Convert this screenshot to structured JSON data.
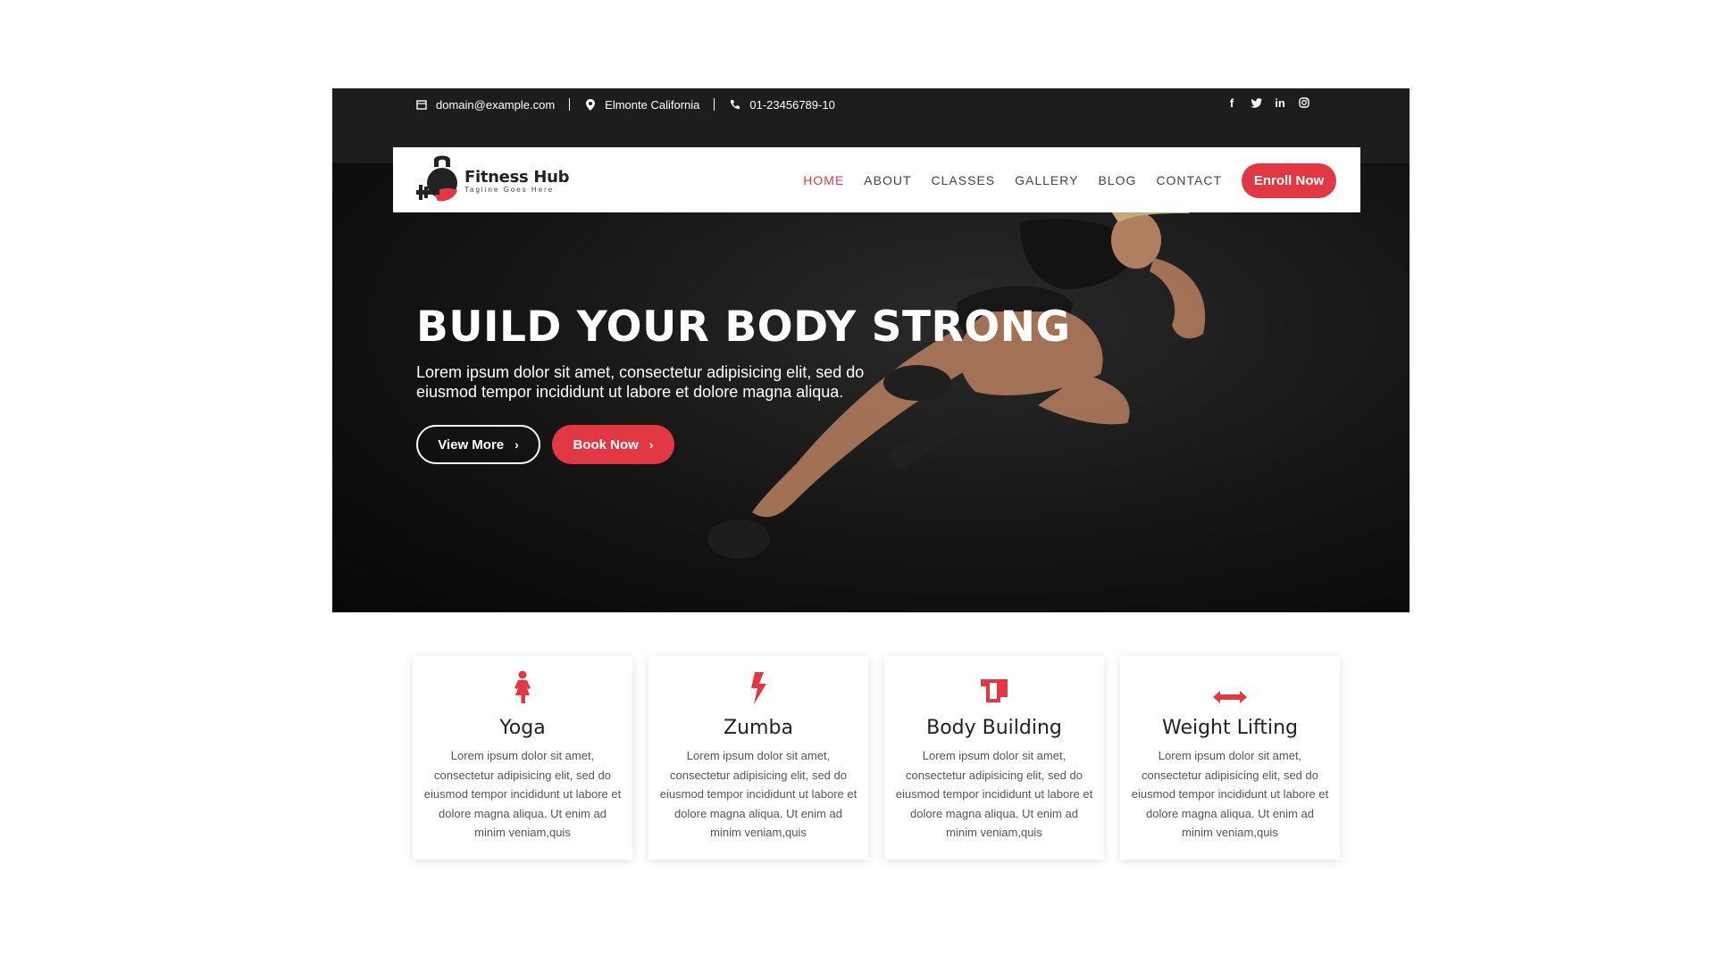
{
  "topbar": {
    "email": "domain@example.com",
    "location": "Elmonte California",
    "phone": "01-23456789-10",
    "social": [
      "facebook-icon",
      "twitter-icon",
      "linkedin-icon",
      "instagram-icon"
    ]
  },
  "brand": {
    "name": "Fitness Hub",
    "tagline": "Tagline Goes Here",
    "accent": "#e23844"
  },
  "nav": {
    "items": [
      {
        "label": "HOME",
        "active": true
      },
      {
        "label": "ABOUT"
      },
      {
        "label": "CLASSES"
      },
      {
        "label": "GALLERY"
      },
      {
        "label": "BLOG"
      },
      {
        "label": "CONTACT"
      }
    ],
    "cta": "Enroll Now"
  },
  "hero": {
    "title": "BUILD YOUR BODY STRONG",
    "text": "Lorem ipsum dolor sit amet, consectetur adipisicing elit, sed do eiusmod tempor incididunt ut labore et dolore magna aliqua.",
    "primary_button": "View More",
    "secondary_button": "Book Now"
  },
  "features": [
    {
      "icon": "female-icon",
      "title": "Yoga",
      "text": "Lorem ipsum dolor sit amet, consectetur adipisicing elit, sed do eiusmod tempor incididunt ut labore et dolore magna aliqua. Ut enim ad minim veniam,quis"
    },
    {
      "icon": "bolt-icon",
      "title": "Zumba",
      "text": "Lorem ipsum dolor sit amet, consectetur adipisicing elit, sed do eiusmod tempor incididunt ut labore et dolore magna aliqua. Ut enim ad minim veniam,quis"
    },
    {
      "icon": "mug-icon",
      "title": "Body Building",
      "text": "Lorem ipsum dolor sit amet, consectetur adipisicing elit, sed do eiusmod tempor incididunt ut labore et dolore magna aliqua. Ut enim ad minim veniam,quis"
    },
    {
      "icon": "arrows-h-icon",
      "title": "Weight Lifting",
      "text": "Lorem ipsum dolor sit amet, consectetur adipisicing elit, sed do eiusmod tempor incididunt ut labore et dolore magna aliqua. Ut enim ad minim veniam,quis"
    }
  ]
}
